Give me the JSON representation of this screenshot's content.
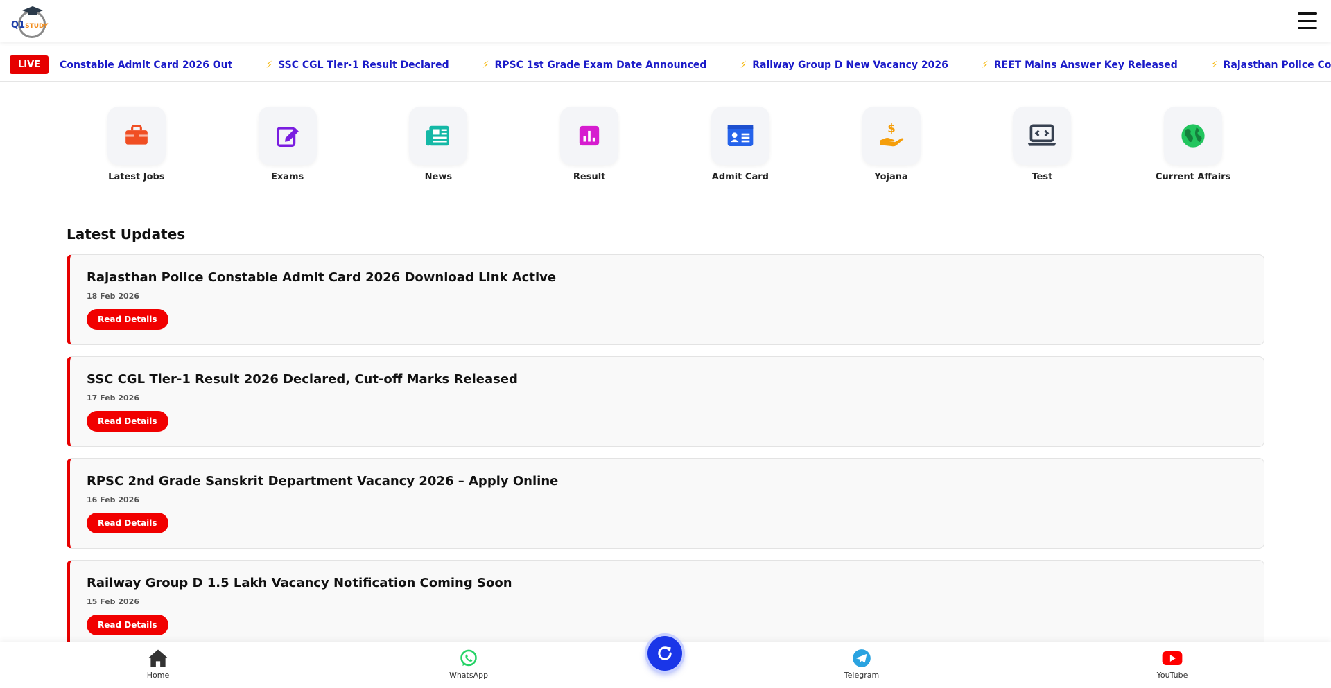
{
  "header": {
    "logo_text_main": "Q1",
    "logo_text_sub": "STUDY"
  },
  "ticker": {
    "live_label": "LIVE",
    "items": [
      "Constable Admit Card 2026 Out",
      "SSC CGL Tier-1 Result Declared",
      "RPSC 1st Grade Exam Date Announced",
      "Railway Group D New Vacancy 2026",
      "REET Mains Answer Key Released",
      "Rajasthan Police Constable Admit Ca"
    ]
  },
  "categories": [
    {
      "label": "Latest Jobs",
      "icon": "briefcase-icon",
      "color": "#f04e23"
    },
    {
      "label": "Exams",
      "icon": "edit-icon",
      "color": "#7a1de0"
    },
    {
      "label": "News",
      "icon": "newspaper-icon",
      "color": "#14b8a6"
    },
    {
      "label": "Result",
      "icon": "chart-icon",
      "color": "#d61ccf"
    },
    {
      "label": "Admit Card",
      "icon": "id-card-icon",
      "color": "#2563eb"
    },
    {
      "label": "Yojana",
      "icon": "money-hand-icon",
      "color": "#f59e0b"
    },
    {
      "label": "Test",
      "icon": "laptop-code-icon",
      "color": "#374151"
    },
    {
      "label": "Current Affairs",
      "icon": "globe-icon",
      "color": "#22c55e"
    }
  ],
  "updates": {
    "title": "Latest Updates",
    "items": [
      {
        "title": "Rajasthan Police Constable Admit Card 2026 Download Link Active",
        "date": "18 Feb 2026",
        "button": "Read Details"
      },
      {
        "title": "SSC CGL Tier-1 Result 2026 Declared, Cut-off Marks Released",
        "date": "17 Feb 2026",
        "button": "Read Details"
      },
      {
        "title": "RPSC 2nd Grade Sanskrit Department Vacancy 2026 – Apply Online",
        "date": "16 Feb 2026",
        "button": "Read Details"
      },
      {
        "title": "Railway Group D 1.5 Lakh Vacancy Notification Coming Soon",
        "date": "15 Feb 2026",
        "button": "Read Details"
      }
    ]
  },
  "bottom_nav": {
    "home": "Home",
    "whatsapp": "WhatsApp",
    "telegram": "Telegram",
    "youtube": "YouTube"
  },
  "colors": {
    "accent_red": "#e60000",
    "ticker_blue": "#1a1ac8",
    "fab_blue": "#1a36e8"
  }
}
